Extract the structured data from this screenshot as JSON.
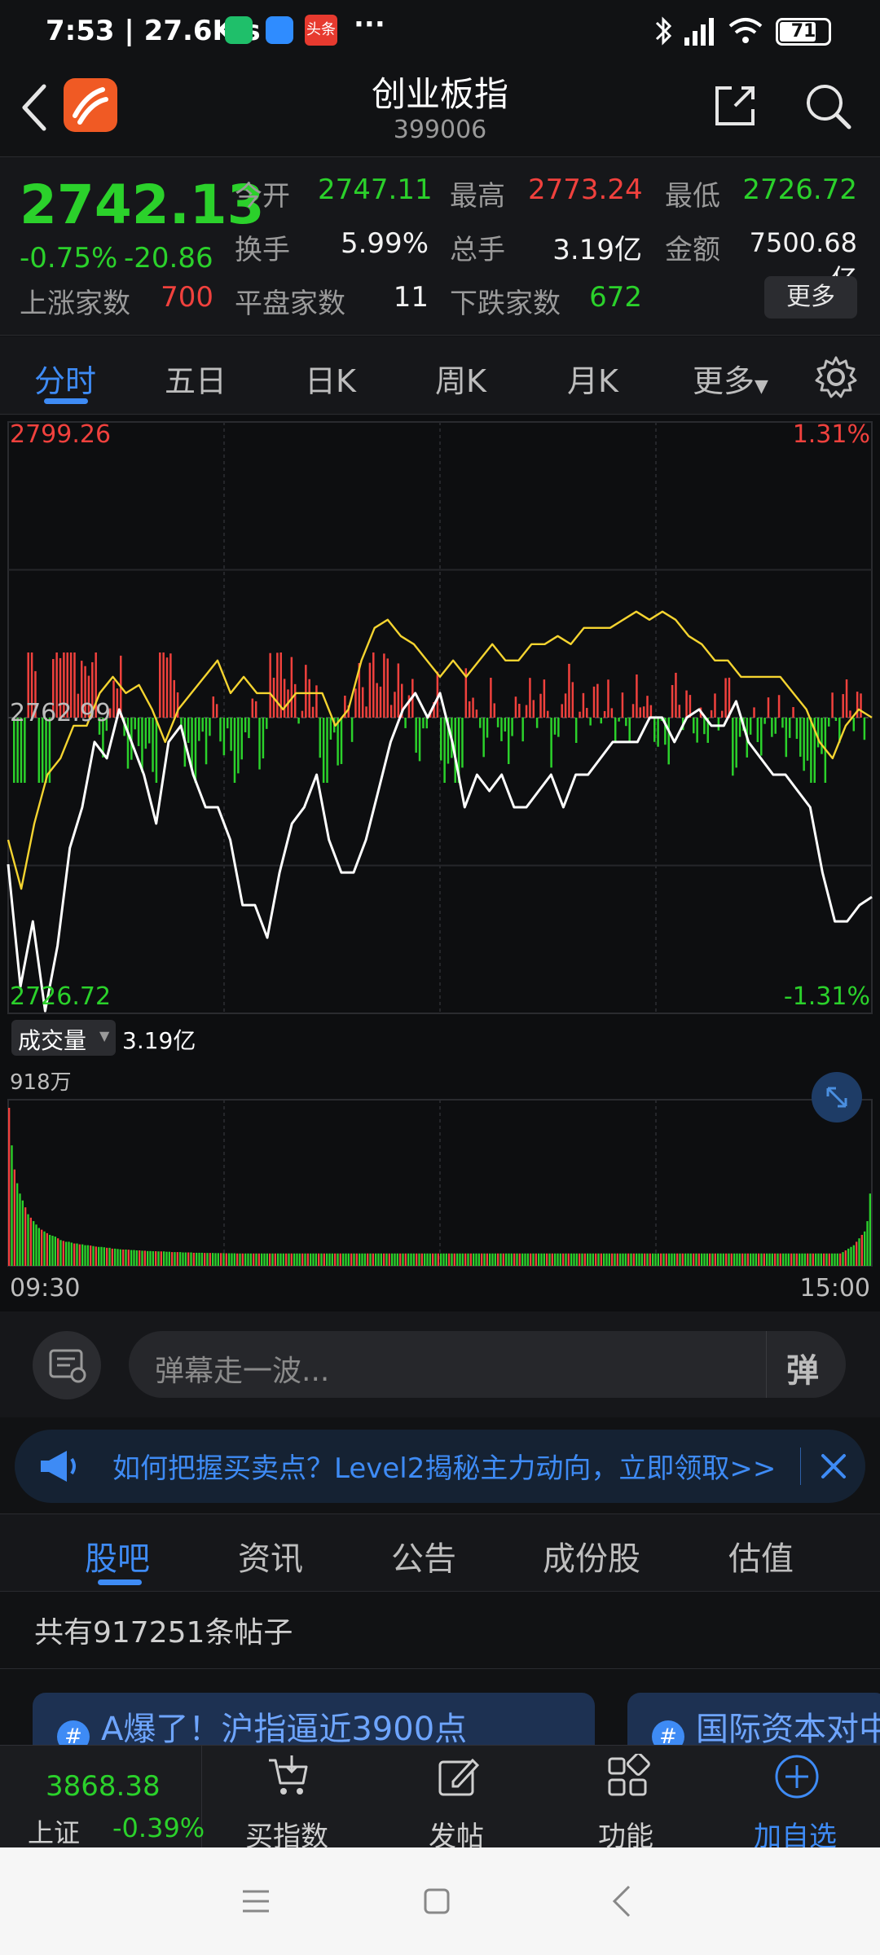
{
  "status_bar": {
    "time_speed": "7:53 | 27.6K/s",
    "dots": "···",
    "battery": "71",
    "app_badge": "头条"
  },
  "header": {
    "title": "创业板指",
    "code": "399006"
  },
  "quote": {
    "price": "2742.13",
    "change_pct": "-0.75%",
    "change": "-20.86",
    "rows": [
      [
        {
          "label": "今开",
          "value": "2747.11",
          "color": "green"
        },
        {
          "label": "最高",
          "value": "2773.24",
          "color": "red"
        },
        {
          "label": "最低",
          "value": "2726.72",
          "color": "green"
        }
      ],
      [
        {
          "label": "换手",
          "value": "5.99%",
          "color": "white"
        },
        {
          "label": "总手",
          "value": "3.19亿",
          "color": "white"
        },
        {
          "label": "金额",
          "value": "7500.68亿",
          "color": "white"
        }
      ]
    ],
    "breadth": {
      "up_label": "上涨家数",
      "up": "700",
      "flat_label": "平盘家数",
      "flat": "11",
      "down_label": "下跌家数",
      "down": "672"
    },
    "more_button": "更多"
  },
  "period_tabs": [
    "分时",
    "五日",
    "日K",
    "周K",
    "月K"
  ],
  "period_more": "更多",
  "active_period": 0,
  "chart_data": {
    "type": "line",
    "x_start_label": "09:30",
    "x_end_label": "15:00",
    "y_max_label": "2799.26",
    "y_mid_label": "2762.99",
    "y_min_label": "2726.72",
    "pct_max_label": "1.31%",
    "pct_min_label": "-1.31%",
    "ylim": [
      2726.72,
      2799.26
    ],
    "prev_close": 2762.99,
    "series": [
      {
        "color": "#ffffff",
        "values": [
          2745,
          2730,
          2738,
          2727,
          2735,
          2747,
          2752,
          2760,
          2758,
          2764,
          2760,
          2756,
          2750,
          2760,
          2762,
          2756,
          2752,
          2752,
          2748,
          2740,
          2740,
          2736,
          2744,
          2750,
          2752,
          2756,
          2748,
          2744,
          2744,
          2748,
          2754,
          2760,
          2764,
          2766,
          2763,
          2766,
          2760,
          2752,
          2756,
          2754,
          2756,
          2752,
          2752,
          2754,
          2756,
          2752,
          2756,
          2756,
          2758,
          2760,
          2760,
          2760,
          2763,
          2763,
          2760,
          2763,
          2764,
          2762,
          2762,
          2765,
          2760,
          2758,
          2756,
          2756,
          2754,
          2752,
          2744,
          2738,
          2738,
          2740,
          2741
        ]
      },
      {
        "color": "#f5d430",
        "values": [
          2748,
          2742,
          2750,
          2756,
          2758,
          2762,
          2762,
          2766,
          2768,
          2766,
          2767,
          2764,
          2760,
          2764,
          2766,
          2768,
          2770,
          2766,
          2768,
          2766,
          2766,
          2764,
          2766,
          2766,
          2766,
          2762,
          2764,
          2770,
          2774,
          2775,
          2773,
          2772,
          2770,
          2768,
          2770,
          2768,
          2770,
          2772,
          2770,
          2770,
          2772,
          2772,
          2773,
          2772,
          2774,
          2774,
          2774,
          2775,
          2776,
          2775,
          2776,
          2775,
          2773,
          2772,
          2770,
          2770,
          2768,
          2768,
          2768,
          2768,
          2766,
          2764,
          2760,
          2758,
          2762,
          2764,
          2763
        ]
      }
    ],
    "volume_label": "成交量",
    "volume_total": "3.19亿",
    "volume_max_label": "918万",
    "volume_bars": [
      918,
      700,
      560,
      480,
      420,
      380,
      340,
      300,
      280,
      260,
      240,
      220,
      210,
      200,
      190,
      180,
      175,
      170,
      160,
      150,
      145,
      140,
      140,
      135,
      130,
      130,
      125,
      125,
      120,
      120,
      118,
      115,
      112,
      110,
      110,
      108,
      105,
      105,
      100,
      100,
      98,
      96,
      95,
      95,
      94,
      92,
      92,
      90,
      90,
      88,
      88,
      86,
      86,
      85,
      85,
      84,
      84,
      84,
      82,
      82,
      80,
      80,
      80,
      80,
      78,
      78,
      78,
      78,
      76,
      76,
      76,
      76,
      75,
      75,
      75,
      75,
      74,
      74,
      74,
      74,
      73,
      73,
      73,
      73,
      72,
      72,
      72,
      72,
      72,
      72,
      72,
      72,
      72,
      72,
      72,
      72,
      72,
      72,
      72,
      72,
      72,
      72,
      72,
      72,
      72,
      72,
      72,
      72,
      72,
      72,
      72,
      72,
      72,
      72,
      72,
      72,
      72,
      72,
      72,
      72,
      72,
      72,
      72,
      72,
      72,
      72,
      72,
      72,
      72,
      72,
      72,
      72,
      72,
      72,
      72,
      72,
      72,
      72,
      72,
      72,
      72,
      72,
      72,
      72,
      72,
      72,
      72,
      72,
      72,
      72,
      72,
      72,
      72,
      72,
      72,
      72,
      72,
      72,
      72,
      72,
      72,
      72,
      72,
      72,
      72,
      72,
      72,
      72,
      72,
      72,
      72,
      72,
      72,
      72,
      72,
      72,
      72,
      72,
      72,
      72,
      72,
      72,
      72,
      72,
      72,
      72,
      72,
      72,
      72,
      72,
      72,
      72,
      72,
      72,
      72,
      72,
      72,
      72,
      72,
      72,
      72,
      72,
      72,
      72,
      72,
      72,
      72,
      72,
      72,
      72,
      72,
      72,
      72,
      72,
      72,
      72,
      72,
      72,
      72,
      72,
      72,
      72,
      72,
      72,
      72,
      72,
      72,
      72,
      72,
      72,
      72,
      72,
      72,
      72,
      72,
      72,
      72,
      72,
      72,
      72,
      72,
      72,
      72,
      72,
      72,
      72,
      72,
      72,
      72,
      72,
      72,
      72,
      72,
      72,
      72,
      72,
      72,
      72,
      72,
      72,
      72,
      72,
      72,
      72,
      72,
      72,
      72,
      72,
      72,
      72,
      72,
      72,
      72,
      72,
      72,
      72,
      72,
      72,
      72,
      72,
      72,
      72,
      72,
      72,
      72,
      72,
      72,
      72,
      72,
      72,
      72,
      72,
      72,
      72,
      72,
      72,
      72,
      72,
      72,
      72,
      72,
      72,
      72,
      72,
      72,
      72,
      72,
      80,
      90,
      100,
      110,
      120,
      140,
      160,
      180,
      200,
      260,
      420
    ],
    "accent_up": "#f0413d",
    "accent_down": "#2bd12b"
  },
  "danmu": {
    "placeholder": "弹幕走一波...",
    "send_label": "弹"
  },
  "banner": {
    "text": "如何把握买卖点？Level2揭秘主力动向，立即领取>>"
  },
  "community_tabs": [
    "股吧",
    "资讯",
    "公告",
    "成份股",
    "估值"
  ],
  "post_count": "共有917251条帖子",
  "cards": [
    {
      "text": "A爆了！沪指逼近3900点"
    },
    {
      "text": "国际资本对中"
    }
  ],
  "toolbar": {
    "index_value": "3868.38",
    "index_name": "上证",
    "index_change": "-0.39%",
    "items": [
      {
        "label": "买指数",
        "icon": "cart-icon"
      },
      {
        "label": "发帖",
        "icon": "edit-icon"
      },
      {
        "label": "功能",
        "icon": "grid-icon"
      },
      {
        "label": "加自选",
        "icon": "plus-circle-icon"
      }
    ]
  }
}
